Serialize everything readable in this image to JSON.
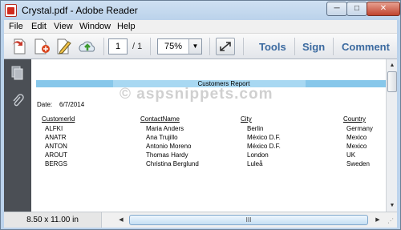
{
  "window": {
    "title": "Crystal.pdf - Adobe Reader",
    "min_glyph": "─",
    "max_glyph": "□",
    "close_glyph": "✕"
  },
  "menu": [
    "File",
    "Edit",
    "View",
    "Window",
    "Help"
  ],
  "toolbar": {
    "page_current": "1",
    "page_total": "/ 1",
    "zoom": "75%",
    "zoom_arrow": "▼",
    "tools_label": "Tools",
    "sign_label": "Sign",
    "comment_label": "Comment"
  },
  "report": {
    "title": "Customers Report",
    "date_label": "Date:",
    "date_value": "6/7/2014",
    "columns": [
      "CustomerId",
      "ContactName",
      "City",
      "Country"
    ],
    "rows": [
      [
        "ALFKI",
        "Maria Anders",
        "Berlin",
        "Germany"
      ],
      [
        "ANATR",
        "Ana Trujillo",
        "México D.F.",
        "Mexico"
      ],
      [
        "ANTON",
        "Antonio Moreno",
        "México D.F.",
        "Mexico"
      ],
      [
        "AROUT",
        "Thomas Hardy",
        "London",
        "UK"
      ],
      [
        "BERGS",
        "Christina Berglund",
        "Luleå",
        "Sweden"
      ]
    ]
  },
  "watermark": "© aspsnippets.com",
  "status": {
    "page_size": "8.50 x 11.00 in",
    "scroll_grip": "III",
    "arrow_left": "◀",
    "arrow_right": "▶",
    "arrow_up": "▲",
    "arrow_down": "▼"
  },
  "colors": {
    "accent": "#3b6aa0",
    "report_bar": "#87c7ea",
    "nav_pane": "#4b4f55"
  }
}
